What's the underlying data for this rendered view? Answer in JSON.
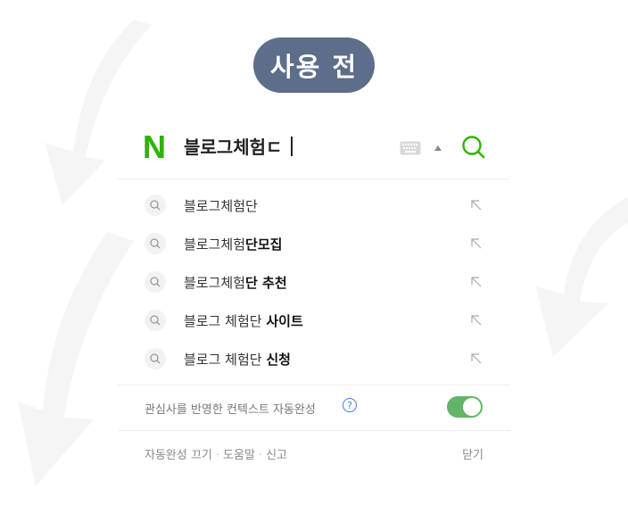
{
  "badge": {
    "label": "사용 전"
  },
  "search": {
    "logo": "N",
    "query": "블로그체험ㄷ"
  },
  "suggestions": [
    {
      "prefix": "블로그체험단",
      "bold": ""
    },
    {
      "prefix": "블로그체험",
      "bold": "단모집"
    },
    {
      "prefix": "블로그체험",
      "bold": "단 추천"
    },
    {
      "prefix": "블로그 체험단 ",
      "bold": "사이트"
    },
    {
      "prefix": "블로그 체험단 ",
      "bold": "신청"
    }
  ],
  "settings": {
    "label": "관심사를 반영한 컨텍스트 자동완성",
    "help": "?",
    "toggle_on": true
  },
  "footer": {
    "link1": "자동완성 끄기",
    "link2": "도움말",
    "link3": "신고",
    "separator": "·",
    "close": "닫기"
  },
  "colors": {
    "badge_bg": "#5d6e8a",
    "logo_green": "#2db400",
    "toggle_green": "#63b469",
    "help_blue": "#3d7be0"
  }
}
